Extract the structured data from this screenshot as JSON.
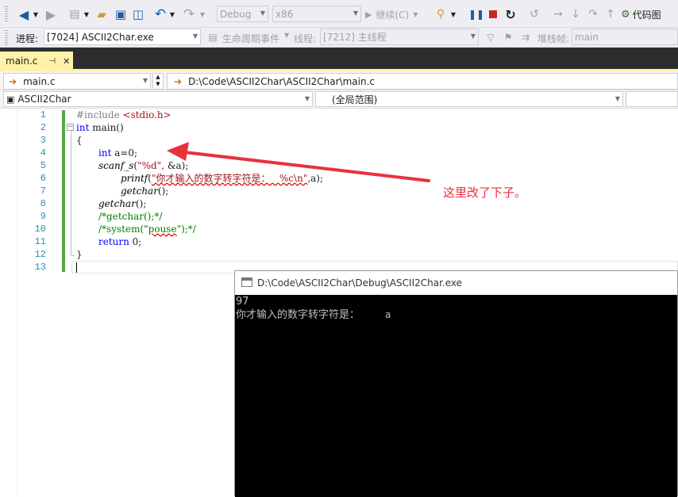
{
  "toolbar": {
    "config": "Debug",
    "platform": "x86",
    "continue_label": "继续(C)",
    "code_map_label": "代码图"
  },
  "debugbar": {
    "process_label": "进程:",
    "process_value": "[7024] ASCII2Char.exe",
    "lifecycle_label": "生命周期事件",
    "thread_label": "线程:",
    "thread_value": "[7212] 主线程",
    "stack_label": "堆栈帧:",
    "stack_value": "main"
  },
  "tab": {
    "name": "main.c",
    "pin": "⊣",
    "close": "✕"
  },
  "nav": {
    "file_combo": "main.c",
    "path": "D:\\Code\\ASCII2Char\\ASCII2Char\\main.c",
    "project_combo": "ASCII2Char",
    "scope_combo": "(全局范围)"
  },
  "code": {
    "line_numbers": [
      "1",
      "2",
      "3",
      "4",
      "5",
      "6",
      "7",
      "8",
      "9",
      "10",
      "11",
      "12",
      "13"
    ],
    "l1_dir": "#include ",
    "l1_hdr": "<stdio.h>",
    "l2_kw": "int",
    "l2_rest": " main()",
    "l3": "{",
    "l4_kw": "int",
    "l4_rest": " a=0;",
    "l5_fn": "scanf_s",
    "l5_a": "(",
    "l5_str": "\"%d\"",
    "l5_b": ", &a);",
    "l6_fn": "printf",
    "l6_a": "(",
    "l6_str": "\"你才输入的数字转字符是：   %c\\n\"",
    "l6_b": ",a);",
    "l7_fn": "getchar",
    "l7_b": "();",
    "l8_fn": "getchar",
    "l8_b": "();",
    "l9": "/*getchar();*/",
    "l10_a": "/*system(\"",
    "l10_sq": "pouse",
    "l10_b": "\");*/",
    "l11_kw": "return",
    "l11_rest": " 0;",
    "l12": "}"
  },
  "annotation": {
    "text": "这里改了下子。",
    "color": "#e8313b"
  },
  "console": {
    "title": "D:\\Code\\ASCII2Char\\Debug\\ASCII2Char.exe",
    "line1": "97",
    "line2_text": "你才输入的数字转字符是：",
    "line2_char": "a"
  }
}
